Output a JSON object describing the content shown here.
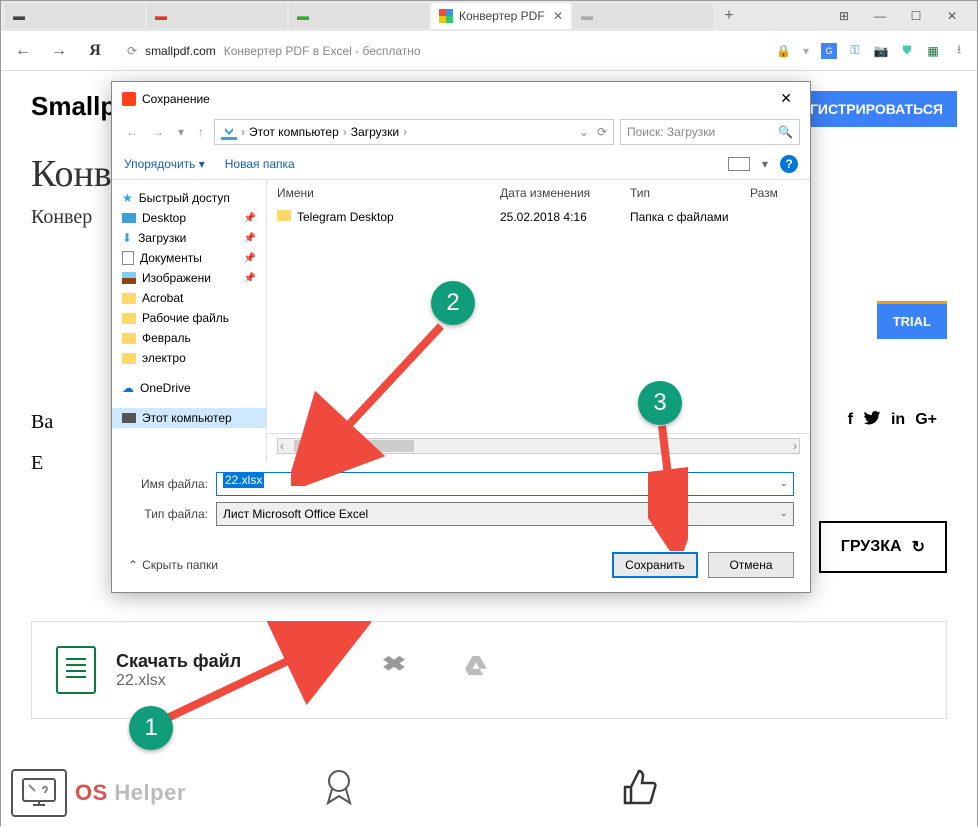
{
  "browser": {
    "tabs": [
      {
        "label": "",
        "active": false
      },
      {
        "label": "",
        "active": false
      },
      {
        "label": "",
        "active": false
      },
      {
        "label": "Конвертер PDF",
        "active": true
      },
      {
        "label": "",
        "active": false
      }
    ],
    "new_tab": "+",
    "win": {
      "tabs_overview": "⊞",
      "min": "—",
      "max": "☐",
      "close": "✕"
    },
    "addr": {
      "domain": "smallpdf.com",
      "path": "Конвертер PDF в Excel - бесплатно"
    }
  },
  "page": {
    "brand": "Smallpdf",
    "h1_vis": "Конв",
    "sub_vis": "Конвер",
    "reg_btn": "ГИСТРИРОВАТЬСЯ",
    "trial_btn": "TRIAL",
    "panel_b": "Ва",
    "panel_e": "E",
    "reload_btn": "ГРУЗКА",
    "dl_title": "Скачать файл",
    "dl_file": "22.xlsx",
    "share": {
      "f": "f",
      "tw": "🐦",
      "in": "in",
      "g": "G+"
    },
    "oshelper_os": "OS",
    "oshelper_rest": " Helper"
  },
  "dialog": {
    "title": "Сохранение",
    "breadcrumb": {
      "root": "Этот компьютер",
      "folder": "Загрузки"
    },
    "search_placeholder": "Поиск: Загрузки",
    "toolbar": {
      "organize": "Упорядочить ▾",
      "newfolder": "Новая папка",
      "help": "?"
    },
    "tree": {
      "quick": "Быстрый доступ",
      "desktop": "Desktop",
      "downloads": "Загрузки",
      "documents": "Документы",
      "images": "Изображени",
      "acrobat": "Acrobat",
      "work": "Рабочие файль",
      "feb": "Февраль",
      "electro": "электро",
      "onedrive": "OneDrive",
      "thispc": "Этот компьютер"
    },
    "cols": {
      "name": "Имени",
      "date": "Дата изменения",
      "type": "Тип",
      "size": "Разм"
    },
    "rows": [
      {
        "name": "Telegram Desktop",
        "date": "25.02.2018 4:16",
        "type": "Папка с файлами"
      }
    ],
    "fields": {
      "name_label": "Имя файла:",
      "name_value": "22.xlsx",
      "type_label": "Тип файла:",
      "type_value": "Лист Microsoft Office Excel"
    },
    "hide_folders": "Скрыть папки",
    "save": "Сохранить",
    "cancel": "Отмена"
  },
  "callouts": {
    "c1": "1",
    "c2": "2",
    "c3": "3"
  }
}
